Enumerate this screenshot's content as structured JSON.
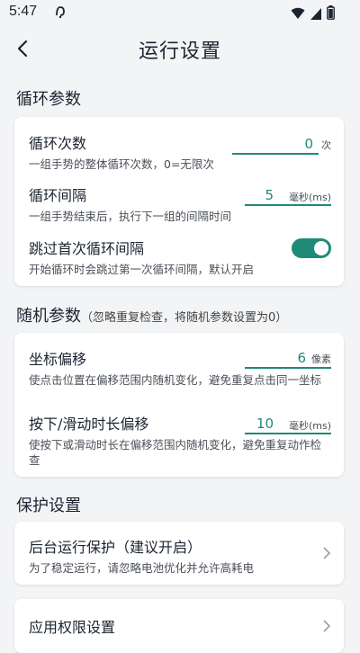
{
  "status_bar": {
    "time": "5:47"
  },
  "header": {
    "title": "运行设置"
  },
  "loop": {
    "section_title": "循环参数",
    "loop_count": {
      "title": "循环次数",
      "value": "0",
      "unit": "次",
      "desc": "一组手势的整体循环次数，0=无限次"
    },
    "loop_interval": {
      "title": "循环间隔",
      "value": "5",
      "unit": "毫秒(ms)",
      "desc": "一组手势结束后，执行下一组的间隔时间"
    },
    "skip_first": {
      "title": "跳过首次循环间隔",
      "enabled": true,
      "desc": "开始循环时会跳过第一次循环间隔，默认开启"
    }
  },
  "random": {
    "section_title": "随机参数",
    "section_note": "（忽略重复检查，将随机参数设置为0）",
    "coord_offset": {
      "title": "坐标偏移",
      "value": "6",
      "unit": "像素",
      "desc": "使点击位置在偏移范围内随机变化，避免重复点击同一坐标"
    },
    "press_offset": {
      "title": "按下/滑动时长偏移",
      "value": "10",
      "unit": "毫秒(ms)",
      "desc": "使按下或滑动时长在偏移范围内随机变化，避免重复动作检查"
    }
  },
  "protect": {
    "section_title": "保护设置",
    "bg_protect": {
      "title": "后台运行保护（建议开启）",
      "desc": "为了稳定运行，请忽略电池优化并允许高耗电"
    },
    "app_permission": {
      "title": "应用权限设置"
    }
  },
  "colors": {
    "accent": "#1f8a78",
    "background": "#f3f4f6",
    "card": "#ffffff"
  },
  "icons": [
    "back-arrow-icon",
    "wifi-icon",
    "signal-icon",
    "battery-icon",
    "chevron-right-icon"
  ]
}
